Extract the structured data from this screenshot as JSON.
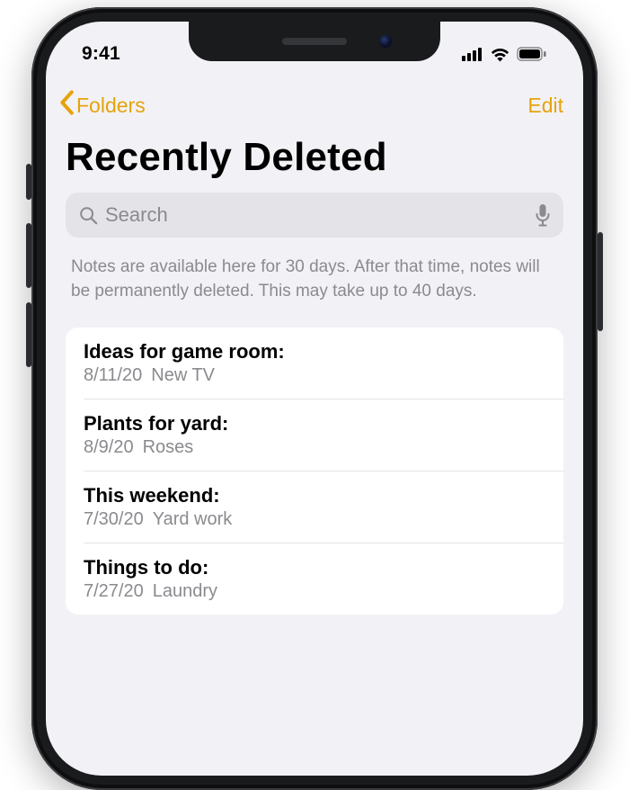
{
  "status": {
    "time": "9:41"
  },
  "nav": {
    "back_label": "Folders",
    "edit_label": "Edit"
  },
  "page_title": "Recently Deleted",
  "search": {
    "placeholder": "Search"
  },
  "info_text": "Notes are available here for 30 days. After that time, notes will be permanently deleted. This may take up to 40 days.",
  "notes": [
    {
      "title": "Ideas for game room:",
      "date": "8/11/20",
      "preview": "New TV"
    },
    {
      "title": "Plants for yard:",
      "date": "8/9/20",
      "preview": "Roses"
    },
    {
      "title": "This weekend:",
      "date": "7/30/20",
      "preview": "Yard work"
    },
    {
      "title": "Things to do:",
      "date": "7/27/20",
      "preview": "Laundry"
    }
  ],
  "colors": {
    "accent": "#e6a30a",
    "bg": "#f2f2f6",
    "search_bg": "#e3e3e8",
    "secondary_text": "#8a8a8f"
  }
}
